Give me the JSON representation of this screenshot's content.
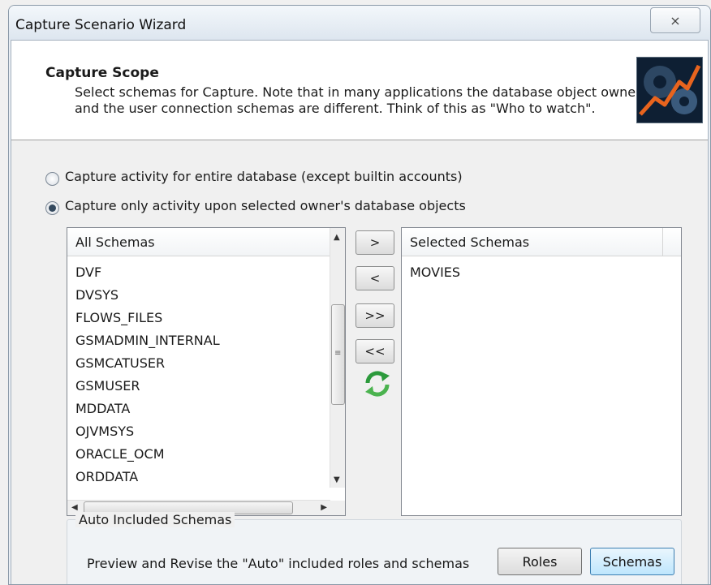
{
  "window": {
    "title": "Capture Scenario Wizard",
    "close_label": "⨯"
  },
  "header": {
    "title": "Capture Scope",
    "description": "Select schemas for Capture. Note that in many applications the database object owner and the user connection schemas are different. Think of this as \"Who to watch\".",
    "image_icon": "chart-gears-icon"
  },
  "scope_options": [
    {
      "label": "Capture activity for entire database (except builtin accounts)",
      "checked": false
    },
    {
      "label": "Capture only activity upon selected owner's database objects",
      "checked": true
    }
  ],
  "all_schemas": {
    "header": "All Schemas",
    "items": [
      "DVF",
      "DVSYS",
      "FLOWS_FILES",
      "GSMADMIN_INTERNAL",
      "GSMCATUSER",
      "GSMUSER",
      "MDDATA",
      "OJVMSYS",
      "ORACLE_OCM",
      "ORDDATA"
    ]
  },
  "selected_schemas": {
    "header": "Selected Schemas",
    "items": [
      "MOVIES"
    ]
  },
  "move_buttons": {
    "add": ">",
    "remove": "<",
    "add_all": ">>",
    "remove_all": "<<",
    "refresh_icon": "refresh-icon"
  },
  "auto_included": {
    "title": "Auto Included Schemas",
    "description": "Preview and Revise the \"Auto\" included roles and schemas",
    "roles_label": "Roles",
    "schemas_label": "Schemas"
  },
  "colors": {
    "accent": "#3c7fb1",
    "refresh_green": "#2c9a3c"
  }
}
